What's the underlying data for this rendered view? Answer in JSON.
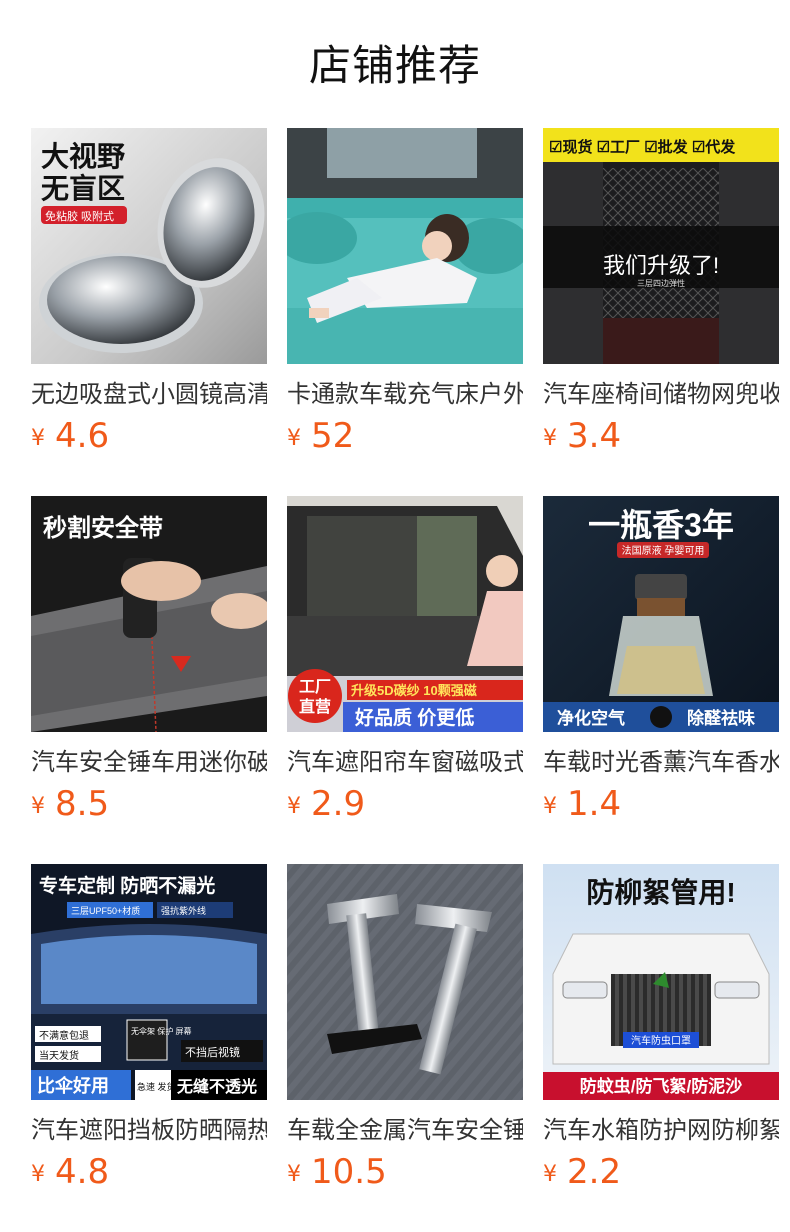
{
  "header": {
    "title": "店铺推荐"
  },
  "currency": "¥",
  "products": [
    {
      "name": "无边吸盘式小圆镜高清",
      "price": "4.6",
      "image_text": [
        "大视野",
        "无盲区",
        "免粘胶 吸附式"
      ]
    },
    {
      "name": "卡通款车载充气床户外",
      "price": "52",
      "image_text": []
    },
    {
      "name": "汽车座椅间储物网兜收",
      "price": "3.4",
      "image_text": [
        "☑现货 ☑工厂 ☑批发 ☑代发",
        "我们升级了!",
        "三层四边弹性"
      ]
    },
    {
      "name": "汽车安全锤车用迷你破",
      "price": "8.5",
      "image_text": [
        "秒割安全带"
      ]
    },
    {
      "name": "汽车遮阳帘车窗磁吸式",
      "price": "2.9",
      "image_text": [
        "工厂",
        "直营",
        "升级5D碳纱 10颗强磁",
        "好品质 价更低"
      ]
    },
    {
      "name": "车载时光香薰汽车香水",
      "price": "1.4",
      "image_text": [
        "一瓶香3年",
        "法国原液 孕婴可用",
        "净化空气",
        "除醛祛味"
      ]
    },
    {
      "name": "汽车遮阳挡板防晒隔热",
      "price": "4.8",
      "image_text": [
        "专车定制 防晒不漏光",
        "三层UPF50+材质",
        "强抗紫外线",
        "不满意包退",
        "当天发货",
        "无伞架 保护 屏幕",
        "不挡后视镜",
        "比伞好用",
        "急速 发货",
        "无缝不透光"
      ]
    },
    {
      "name": "车载全金属汽车安全锤",
      "price": "10.5",
      "image_text": []
    },
    {
      "name": "汽车水箱防护网防柳絮",
      "price": "2.2",
      "image_text": [
        "防柳絮管用!",
        "汽车防虫口罩",
        "防蚊虫/防飞絮/防泥沙"
      ]
    }
  ],
  "colors": {
    "price": "#f05a1a",
    "title": "#111111",
    "name": "#333333"
  }
}
